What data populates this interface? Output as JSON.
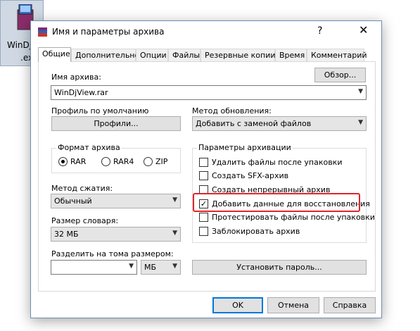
{
  "desktop_icon": {
    "label_line1": "WinDj",
    "label_line2": ".ex"
  },
  "window": {
    "title": "Имя и параметры архива",
    "help_glyph": "?",
    "close_glyph": "✕"
  },
  "tabs": [
    {
      "label": "Общие",
      "active": true
    },
    {
      "label": "Дополнительно"
    },
    {
      "label": "Опции"
    },
    {
      "label": "Файлы"
    },
    {
      "label": "Резервные копии"
    },
    {
      "label": "Время"
    },
    {
      "label": "Комментарий"
    }
  ],
  "general": {
    "archive_name_label": "Имя архива:",
    "browse_button": "Обзор...",
    "archive_name_value": "WinDjView.rar",
    "default_profile_label": "Профиль по умолчанию",
    "profiles_button": "Профили...",
    "update_method_label": "Метод обновления:",
    "update_method_value": "Добавить с заменой файлов",
    "format_group_title": "Формат архива",
    "formats": [
      "RAR",
      "RAR4",
      "ZIP"
    ],
    "compression_label": "Метод сжатия:",
    "compression_value": "Обычный",
    "dictionary_label": "Размер словаря:",
    "dictionary_value": "32 МБ",
    "split_label": "Разделить на тома размером:",
    "split_value": "",
    "split_unit": "МБ",
    "set_password_button": "Установить пароль...",
    "archiving_params_title": "Параметры архивации",
    "options": [
      {
        "label": "Удалить файлы после упаковки",
        "checked": false
      },
      {
        "label": "Создать SFX-архив",
        "checked": false
      },
      {
        "label": "Создать непрерывный архив",
        "checked": false
      },
      {
        "label": "Добавить данные для восстановления",
        "checked": true
      },
      {
        "label": "Протестировать файлы после упаковки",
        "checked": false
      },
      {
        "label": "Заблокировать архив",
        "checked": false
      }
    ]
  },
  "footer": {
    "ok": "OK",
    "cancel": "Отмена",
    "help": "Справка"
  },
  "colors": {
    "highlight": "#e1242b",
    "accent": "#0078d7"
  },
  "icons": {
    "check_glyph": "✓",
    "arrow_glyph": "▼"
  }
}
